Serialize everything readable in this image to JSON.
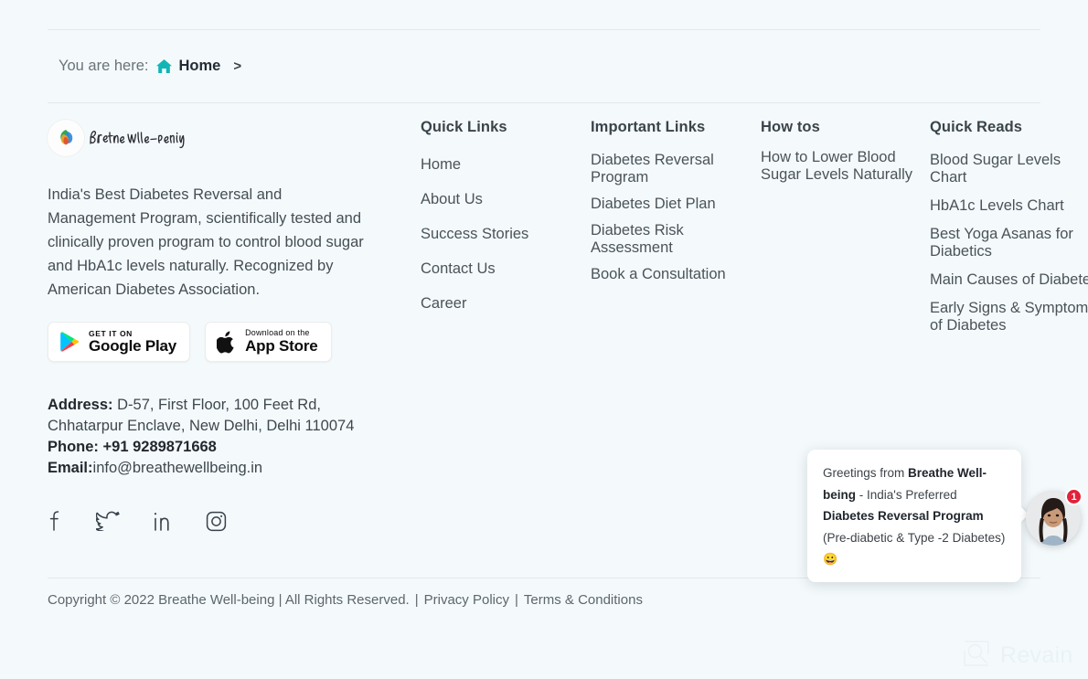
{
  "breadcrumb": {
    "prefix": "You are here:",
    "home_icon": "home-icon",
    "current": "Home",
    "separator": ">"
  },
  "brand": {
    "logo_icon": "breathe-wellbeing-logo",
    "logo_text": "Breathe Well-being",
    "description": "India's Best Diabetes Reversal and Management Program, scientifically tested and clinically proven program to control blood sugar and HbA1c levels naturally. Recognized by American Diabetes Association.",
    "stores": [
      {
        "icon": "google-play-icon",
        "small": "GET IT ON",
        "big": "Google Play"
      },
      {
        "icon": "apple-icon",
        "small": "Download on the",
        "big": "App Store"
      }
    ],
    "contact": {
      "address_label": "Address:",
      "address_line1": "D-57, First Floor, 100 Feet Rd,",
      "address_line2": "Chhatarpur Enclave, New Delhi, Delhi 110074",
      "phone_label": "Phone:",
      "phone_value": "+91 9289871668",
      "email_label": "Email:",
      "email_value": "info@breathewellbeing.in"
    },
    "social": [
      {
        "icon": "facebook-icon",
        "name": "Facebook"
      },
      {
        "icon": "twitter-icon",
        "name": "Twitter"
      },
      {
        "icon": "linkedin-icon",
        "name": "LinkedIn"
      },
      {
        "icon": "instagram-icon",
        "name": "Instagram"
      }
    ]
  },
  "columns": [
    {
      "title": "Quick Links",
      "links": [
        "Home",
        "About Us",
        "Success Stories",
        "Contact Us",
        "Career"
      ]
    },
    {
      "title": "Important Links",
      "links": [
        "Diabetes Reversal Program",
        "Diabetes Diet Plan",
        "Diabetes Risk Assessment",
        "Book a Consultation"
      ]
    },
    {
      "title": "How tos",
      "links": [
        "How to Lower Blood Sugar Levels Naturally"
      ]
    },
    {
      "title": "Quick Reads",
      "links": [
        "Blood Sugar Levels Chart",
        "HbA1c Levels Chart",
        "Best Yoga Asanas for Diabetics",
        "Main Causes of Diabetes",
        "Early Signs & Symptoms of Diabetes"
      ]
    }
  ],
  "copyright": {
    "text": "Copyright © 2022 Breathe Well-being | All Rights Reserved.",
    "pipe": "|",
    "privacy": "Privacy Policy",
    "terms": "Terms & Conditions"
  },
  "chat": {
    "greeting_prefix": "Greetings from ",
    "brand": "Breathe Well-being",
    "middle": " - India's Preferred ",
    "program": "Diabetes Reversal Program",
    "suffix": " (Pre-diabetic & Type -2 Diabetes) ",
    "emoji": "😀",
    "badge_count": "1",
    "avatar_icon": "agent-avatar"
  },
  "watermark": {
    "icon": "revain-logo-icon",
    "text": "Revain"
  },
  "colors": {
    "background": "#f4fafc",
    "divider": "#e3e8eb",
    "text": "#4a5258",
    "heading": "#3b444b",
    "home_icon": "#1fb6b6",
    "badge": "#e2213a"
  }
}
